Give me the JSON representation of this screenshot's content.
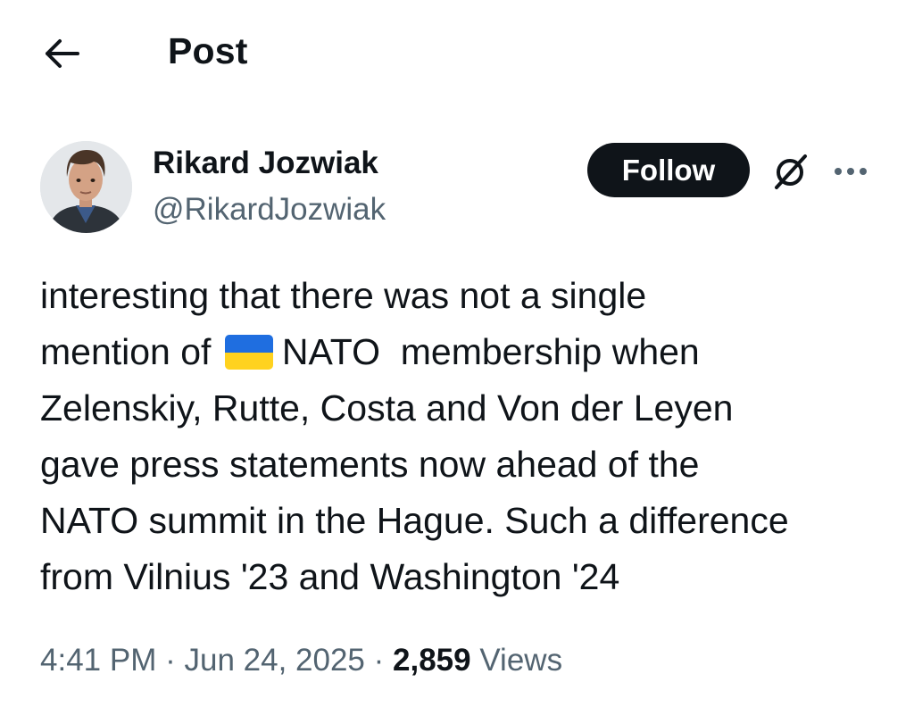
{
  "header": {
    "back_icon": "arrow-left-icon",
    "title": "Post"
  },
  "author": {
    "name": "Rikard Jozwiak",
    "handle": "@RikardJozwiak",
    "avatar_icon": "avatar-photo"
  },
  "actions": {
    "follow_label": "Follow",
    "grok_icon": "grok-icon",
    "more_icon": "more-horizontal-icon"
  },
  "post": {
    "lines": [
      "interesting that there was not a single",
      "mention of",
      "NATO  membership when",
      "Zelenskiy, Rutte, Costa and Von der Leyen",
      "gave press statements now ahead of the",
      "NATO summit in the Hague. Such a difference",
      "from Vilnius '23 and Washington '24"
    ],
    "flag_emoji": "ukraine-flag-emoji"
  },
  "meta": {
    "time": "4:41 PM",
    "separator": "·",
    "date": "Jun 24, 2025",
    "views_count": "2,859",
    "views_label": "Views"
  },
  "colors": {
    "text_primary": "#0f1419",
    "text_secondary": "#536471",
    "follow_bg": "#0f1419",
    "flag_blue": "#1f6ee0",
    "flag_yellow": "#ffd21f"
  }
}
